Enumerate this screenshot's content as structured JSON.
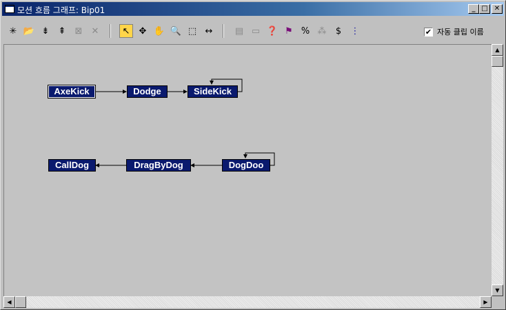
{
  "window": {
    "title": "모션 흐름 그래프: Bip01",
    "min_glyph": "_",
    "max_glyph": "□",
    "close_glyph": "✕"
  },
  "toolbar": {
    "tools": [
      {
        "name": "create-motion-icon",
        "glyph": "✳",
        "enabled": true
      },
      {
        "name": "load-files-icon",
        "glyph": "📂",
        "enabled": true
      },
      {
        "name": "create-transitions-icon",
        "glyph": "⇟",
        "enabled": true
      },
      {
        "name": "create-random-transitions-icon",
        "glyph": "⇞",
        "enabled": true
      },
      {
        "name": "delete-selected-icon",
        "glyph": "⊠",
        "enabled": false
      },
      {
        "name": "delete-icon",
        "glyph": "✕",
        "enabled": false
      },
      {
        "name": "select-icon",
        "glyph": "↖",
        "enabled": true,
        "pressed": true
      },
      {
        "name": "move-icon",
        "glyph": "✥",
        "enabled": true
      },
      {
        "name": "pan-icon",
        "glyph": "✋",
        "enabled": true
      },
      {
        "name": "zoom-icon",
        "glyph": "🔍",
        "enabled": true
      },
      {
        "name": "zoom-region-icon",
        "glyph": "⬚",
        "enabled": true
      },
      {
        "name": "fit-icon",
        "glyph": "↔",
        "enabled": true
      },
      {
        "name": "show-scripts-icon",
        "glyph": "▤",
        "enabled": false
      },
      {
        "name": "collapse-icon",
        "glyph": "▭",
        "enabled": false
      },
      {
        "name": "properties-icon",
        "glyph": "❓",
        "enabled": false
      },
      {
        "name": "set-start-icon",
        "glyph": "⚑",
        "enabled": true
      },
      {
        "name": "percent-icon",
        "glyph": "%",
        "enabled": true
      },
      {
        "name": "optimize-icon",
        "glyph": "⁂",
        "enabled": false
      },
      {
        "name": "cost-icon",
        "glyph": "$",
        "enabled": true
      },
      {
        "name": "script-info-icon",
        "glyph": "⋮",
        "enabled": true
      }
    ],
    "auto_clip_names": {
      "label": "자동 클립 이름",
      "checked": true,
      "check_glyph": "✔"
    }
  },
  "graph": {
    "nodes": [
      {
        "id": "axekick",
        "label": "AxeKick",
        "selected": true
      },
      {
        "id": "dodge",
        "label": "Dodge"
      },
      {
        "id": "sidekick",
        "label": "SideKick",
        "self_loop": true
      },
      {
        "id": "calldog",
        "label": "CallDog"
      },
      {
        "id": "dragbydog",
        "label": "DragByDog"
      },
      {
        "id": "dogdoo",
        "label": "DogDoo",
        "self_loop": true
      }
    ],
    "edges": [
      {
        "from": "axekick",
        "to": "dodge"
      },
      {
        "from": "dodge",
        "to": "sidekick"
      },
      {
        "from": "sidekick",
        "to": "sidekick"
      },
      {
        "from": "dogdoo",
        "to": "dragbydog"
      },
      {
        "from": "dragbydog",
        "to": "calldog"
      },
      {
        "from": "dogdoo",
        "to": "dogdoo"
      }
    ]
  },
  "scrollbars": {
    "up": "▲",
    "down": "▼",
    "left": "◀",
    "right": "▶"
  }
}
